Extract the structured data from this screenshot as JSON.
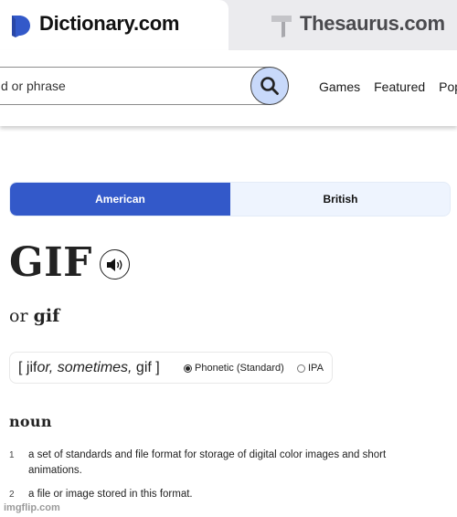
{
  "site_tabs": {
    "dictionary": {
      "label": "Dictionary.com",
      "icon": "dictionary-logo-icon",
      "brand_color": "#3359c9",
      "active": true
    },
    "thesaurus": {
      "label": "Thesaurus.com",
      "icon": "thesaurus-logo-icon",
      "active": false
    }
  },
  "search": {
    "placeholder": "d or phrase",
    "value": "",
    "button_icon": "search-icon"
  },
  "nav": {
    "items": [
      "Games",
      "Featured",
      "Pop"
    ]
  },
  "dialect_toggle": {
    "options": [
      "American",
      "British"
    ],
    "selected": "American",
    "accent": "#3359c9"
  },
  "entry": {
    "headword": "GIF",
    "audio_icon": "speaker-icon",
    "variant_prefix": "or",
    "variant": "gif",
    "pronunciation": {
      "open": "[ ",
      "part1": "jif",
      "part2_italic": "or, sometimes,",
      "part3": " gif",
      "close": " ]",
      "modes": [
        "Phonetic (Standard)",
        "IPA"
      ],
      "selected_mode": "Phonetic (Standard)"
    },
    "part_of_speech": "noun",
    "definitions": [
      {
        "number": "1",
        "text": "a set of standards and file format for storage of digital color images and short animations."
      },
      {
        "number": "2",
        "text": "a file or image stored in this format."
      }
    ]
  },
  "watermark": "imgflip.com"
}
